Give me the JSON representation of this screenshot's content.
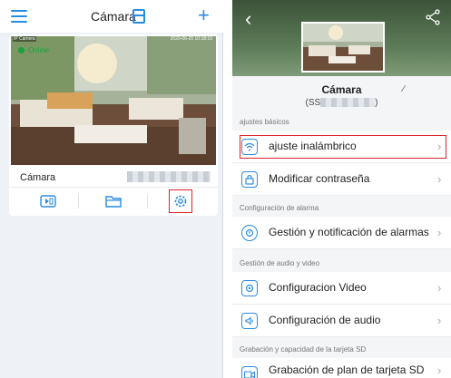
{
  "left": {
    "header": {
      "title": "Cámara"
    },
    "camera": {
      "status": "Online",
      "overlay_label": "IP Camera",
      "timestamp": "2020-06-20 10:18:10",
      "name": "Cámara"
    }
  },
  "right": {
    "camera_name": "Cámara",
    "camera_uid_prefix": "(SS",
    "camera_uid_suffix": ")",
    "sections": [
      {
        "header": "ajustes básicos",
        "items": [
          "ajuste inalámbrico",
          "Modificar contraseña"
        ]
      },
      {
        "header": "Configuración de alarma",
        "items": [
          "Gestión y notificación de alarmas"
        ]
      },
      {
        "header": "Gestión de audio y video",
        "items": [
          "Configuracion Video",
          "Configuración de audio"
        ]
      },
      {
        "header": "Grabación y capacidad de la tarjeta SD",
        "items": [
          "Grabación de plan de tarjeta SD"
        ]
      }
    ]
  },
  "colors": {
    "accent": "#2b8be0",
    "online": "#1aa33c",
    "highlight": "#d9242b"
  }
}
